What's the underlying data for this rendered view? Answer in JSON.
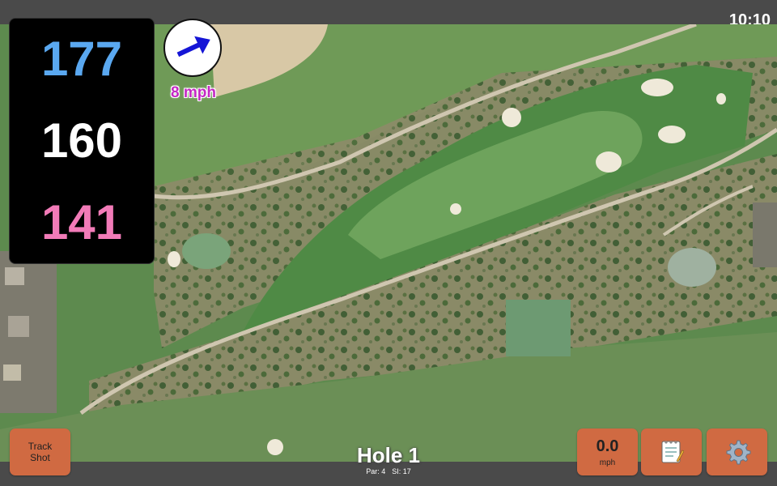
{
  "status": {
    "time": "10:10"
  },
  "distances": {
    "back": "177",
    "middle": "160",
    "front": "141"
  },
  "wind": {
    "speed": "8 mph",
    "icon": "wind-direction-arrow-icon"
  },
  "buttons": {
    "track_shot_label": "Track\nShot",
    "speed_value": "0.0",
    "speed_unit": "mph",
    "notes_icon": "notepad-icon",
    "settings_icon": "gear-icon"
  },
  "hole": {
    "title": "Hole 1",
    "par": "Par: 4",
    "si": "SI: 17"
  },
  "colors": {
    "button": "#d06a42",
    "back_distance": "#5aa8f0",
    "middle_distance": "#ffffff",
    "front_distance": "#f27bb8",
    "wind_speed": "#c428c4"
  }
}
